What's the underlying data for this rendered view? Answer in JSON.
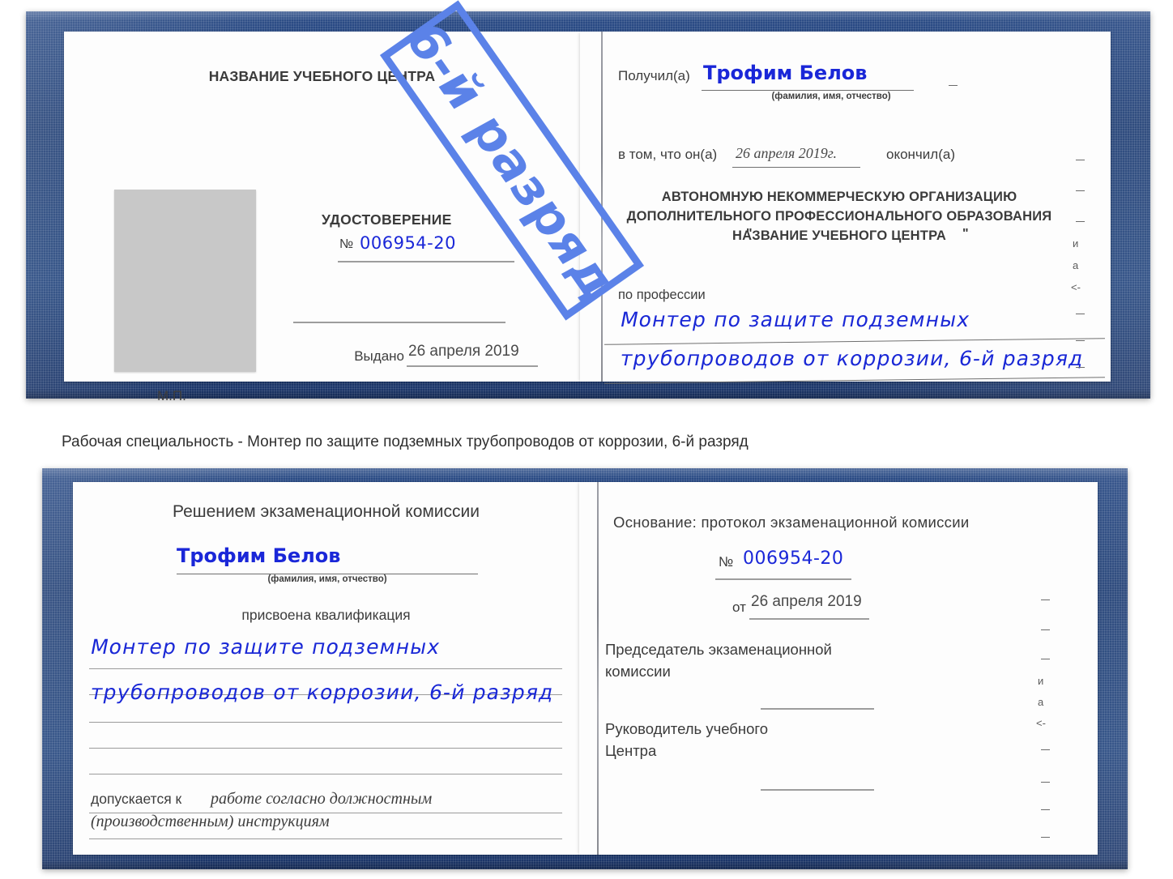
{
  "caption": {
    "text": "Рабочая специальность - Монтер по защите подземных трубопроводов от коррозии, 6-й разряд"
  },
  "watermark": {
    "text": "6-й разряд",
    "color": "#5b82e8"
  },
  "colors": {
    "cover_blue": "#22427a",
    "ink_blue": "#1a28d6",
    "paper": "#fdfdfd",
    "photo_gray": "#c8c8c8",
    "rule_gray": "#9b9b9b"
  },
  "certificate_top": {
    "left_page": {
      "heading": "НАЗВАНИЕ УЧЕБНОГО ЦЕНТРА",
      "doc_title": "УДОСТОВЕРЕНИЕ",
      "number_label": "№",
      "number_value": "006954-20",
      "issued_label": "Выдано",
      "issued_value": "26 апреля 2019",
      "seal_label": "М.П.",
      "photo_placeholder": "photo-placeholder"
    },
    "right_page": {
      "received_label": "Получил(а)",
      "received_value": "Трофим Белов",
      "received_hint": "(фамилия, имя, отчество)",
      "that_he_label": "в том, что он(а)",
      "that_he_value": "26 апреля 2019г.",
      "finished_label": "окончил(а)",
      "org_line1": "АВТОНОМНУЮ НЕКОММЕРЧЕСКУЮ ОРГАНИЗАЦИЮ",
      "org_line2": "ДОПОЛНИТЕЛЬНОГО ПРОФЕССИОНАЛЬНОГО ОБРАЗОВАНИЯ",
      "org_quote_open": "\"",
      "org_line3": "НАЗВАНИЕ УЧЕБНОГО ЦЕНТРА",
      "org_quote_close": "\"",
      "profession_label": "по профессии",
      "profession_line1": "Монтер по защите подземных",
      "profession_line2": "трубопроводов от коррозии, 6-й разряд",
      "edge_fragments": [
        "и",
        "а",
        "<-"
      ]
    }
  },
  "certificate_bottom": {
    "left_page": {
      "heading": "Решением экзаменационной комиссии",
      "name_value": "Трофим Белов",
      "name_hint": "(фамилия, имя, отчество)",
      "qualification_label": "присвоена квалификация",
      "qualification_line1": "Монтер по защите подземных",
      "qualification_line2": "трубопроводов от коррозии, 6-й разряд",
      "admitted_label": "допускается к",
      "admitted_line1": "работе согласно должностным",
      "admitted_line2": "(производственным) инструкциям"
    },
    "right_page": {
      "basis_label": "Основание: протокол экзаменационной комиссии",
      "number_label": "№",
      "number_value": "006954-20",
      "date_label": "от",
      "date_value": "26 апреля 2019",
      "chairman_line1": "Председатель экзаменационной",
      "chairman_line2": "комиссии",
      "head_line1": "Руководитель учебного",
      "head_line2": "Центра",
      "edge_fragments": [
        "и",
        "а",
        "<-"
      ]
    }
  }
}
